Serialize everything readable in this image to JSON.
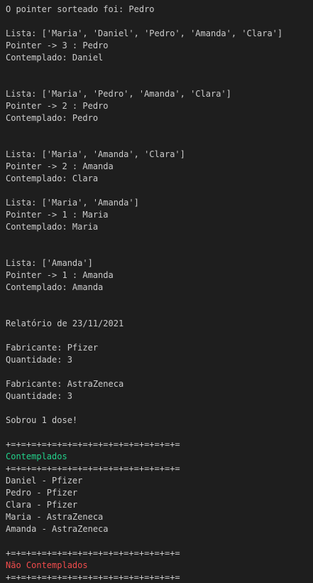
{
  "terminal": {
    "lines": [
      {
        "text": "O pointer sorteado foi: Pedro",
        "style": ""
      },
      {
        "text": "",
        "style": ""
      },
      {
        "text": "Lista: ['Maria', 'Daniel', 'Pedro', 'Amanda', 'Clara']",
        "style": ""
      },
      {
        "text": "Pointer -> 3 : Pedro",
        "style": ""
      },
      {
        "text": "Contemplado: Daniel",
        "style": ""
      },
      {
        "text": "",
        "style": ""
      },
      {
        "text": "",
        "style": ""
      },
      {
        "text": "Lista: ['Maria', 'Pedro', 'Amanda', 'Clara']",
        "style": ""
      },
      {
        "text": "Pointer -> 2 : Pedro",
        "style": ""
      },
      {
        "text": "Contemplado: Pedro",
        "style": ""
      },
      {
        "text": "",
        "style": ""
      },
      {
        "text": "",
        "style": ""
      },
      {
        "text": "Lista: ['Maria', 'Amanda', 'Clara']",
        "style": ""
      },
      {
        "text": "Pointer -> 2 : Amanda",
        "style": ""
      },
      {
        "text": "Contemplado: Clara",
        "style": ""
      },
      {
        "text": "",
        "style": ""
      },
      {
        "text": "Lista: ['Maria', 'Amanda']",
        "style": ""
      },
      {
        "text": "Pointer -> 1 : Maria",
        "style": ""
      },
      {
        "text": "Contemplado: Maria",
        "style": ""
      },
      {
        "text": "",
        "style": ""
      },
      {
        "text": "",
        "style": ""
      },
      {
        "text": "Lista: ['Amanda']",
        "style": ""
      },
      {
        "text": "Pointer -> 1 : Amanda",
        "style": ""
      },
      {
        "text": "Contemplado: Amanda",
        "style": ""
      },
      {
        "text": "",
        "style": ""
      },
      {
        "text": "",
        "style": ""
      },
      {
        "text": "Relatório de 23/11/2021",
        "style": ""
      },
      {
        "text": "",
        "style": ""
      },
      {
        "text": "Fabricante: Pfizer",
        "style": ""
      },
      {
        "text": "Quantidade: 3",
        "style": ""
      },
      {
        "text": "",
        "style": ""
      },
      {
        "text": "Fabricante: AstraZeneca",
        "style": ""
      },
      {
        "text": "Quantidade: 3",
        "style": ""
      },
      {
        "text": "",
        "style": ""
      },
      {
        "text": "Sobrou 1 dose!",
        "style": ""
      },
      {
        "text": "",
        "style": ""
      },
      {
        "text": "+=+=+=+=+=+=+=+=+=+=+=+=+=+=+=+=+=",
        "style": ""
      },
      {
        "text": "Contemplados",
        "style": "green"
      },
      {
        "text": "+=+=+=+=+=+=+=+=+=+=+=+=+=+=+=+=+=",
        "style": ""
      },
      {
        "text": "Daniel - Pfizer",
        "style": ""
      },
      {
        "text": "Pedro - Pfizer",
        "style": ""
      },
      {
        "text": "Clara - Pfizer",
        "style": ""
      },
      {
        "text": "Maria - AstraZeneca",
        "style": ""
      },
      {
        "text": "Amanda - AstraZeneca",
        "style": ""
      },
      {
        "text": "",
        "style": ""
      },
      {
        "text": "+=+=+=+=+=+=+=+=+=+=+=+=+=+=+=+=+=",
        "style": ""
      },
      {
        "text": "Não Contemplados",
        "style": "red"
      },
      {
        "text": "+=+=+=+=+=+=+=+=+=+=+=+=+=+=+=+=+=",
        "style": ""
      }
    ]
  },
  "colors": {
    "background": "#1e1e1e",
    "text": "#cccccc",
    "accent_green": "#23d18b",
    "accent_red": "#f14c4c"
  }
}
